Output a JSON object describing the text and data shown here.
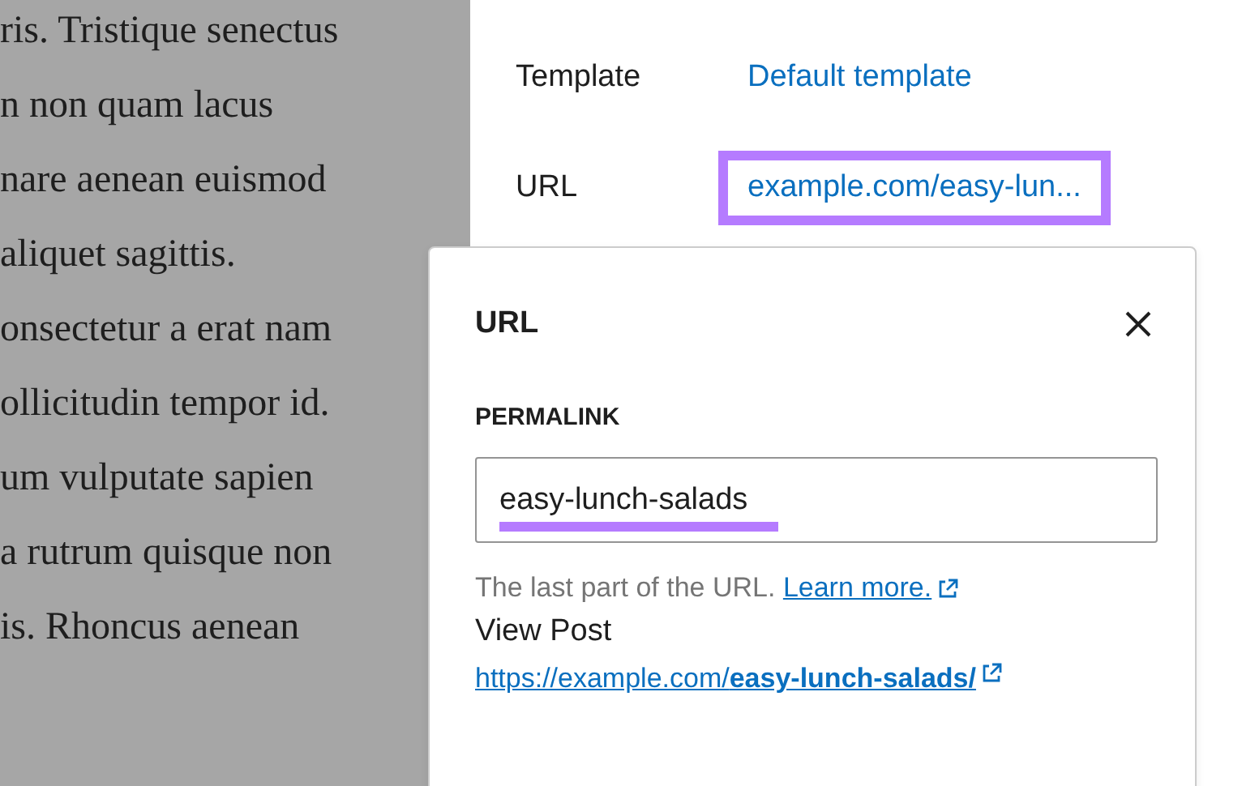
{
  "editor_text": [
    "ris. Tristique senectus",
    "n non quam lacus",
    "nare aenean euismod",
    "aliquet sagittis.",
    "onsectetur a erat nam",
    "ollicitudin tempor id.",
    "um vulputate sapien",
    "a rutrum quisque non",
    "is. Rhoncus aenean"
  ],
  "settings": [
    {
      "label": "Template",
      "value": "Default template",
      "highlighted": false
    },
    {
      "label": "URL",
      "value": "example.com/easy-lun...",
      "highlighted": true
    }
  ],
  "popover": {
    "title": "URL",
    "field_label": "PERMALINK",
    "field_value": "easy-lunch-salads",
    "field_underlined": true,
    "help_text": "The last part of the URL.",
    "help_link": "Learn more.",
    "view_post_label": "View Post",
    "view_post_link": "https://example.com/**easy-lunch-salads/**"
  }
}
